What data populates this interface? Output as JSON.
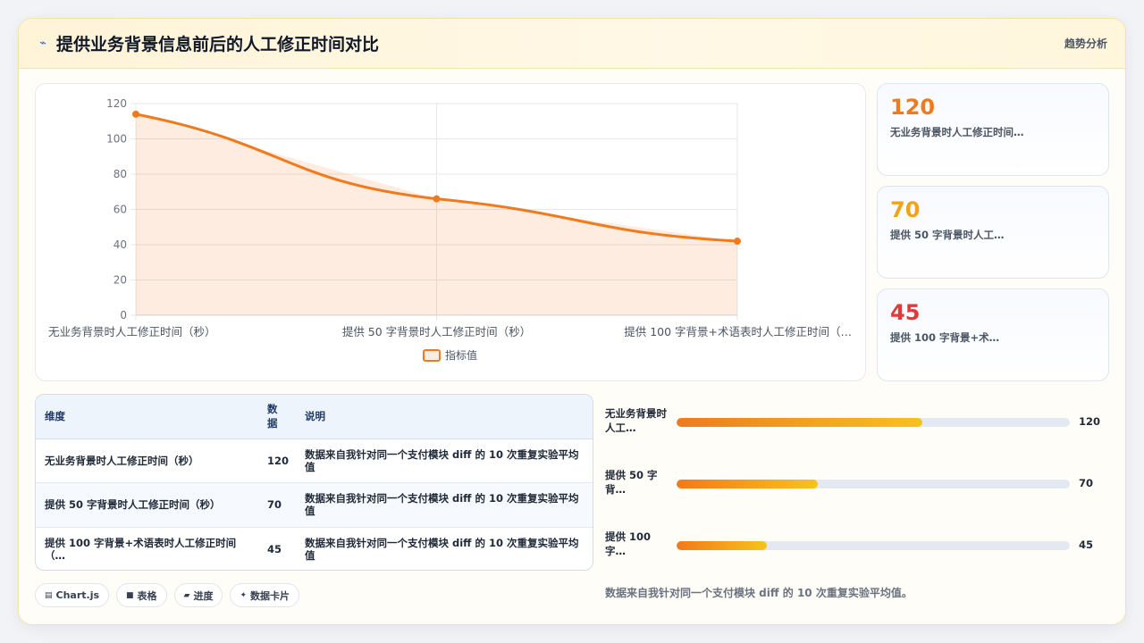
{
  "header": {
    "icon": "sparkle-icon",
    "title": "提供业务背景信息前后的人工修正时间对比",
    "badge": "趋势分析"
  },
  "chart_data": {
    "type": "area",
    "categories": [
      "无业务背景时人工修正时间（秒）",
      "提供 50 字背景时人工修正时间（秒）",
      "提供 100 字背景+术语表时人工修正时间（…"
    ],
    "series": [
      {
        "name": "指标值",
        "values": [
          114,
          66,
          42
        ],
        "color": "#f07a1c"
      }
    ],
    "ylim": [
      0,
      120
    ],
    "yticks": [
      "0",
      "20",
      "40",
      "60",
      "80",
      "100",
      "120"
    ],
    "grid": true,
    "legend": "bottom"
  },
  "stats": [
    {
      "value": "120",
      "label": "无业务背景时人工修正时间…",
      "color": "#f07a1c"
    },
    {
      "value": "70",
      "label": "提供 50 字背景时人工…",
      "color": "#f0a21c"
    },
    {
      "value": "45",
      "label": "提供 100 字背景+术…",
      "color": "#e03a3a"
    }
  ],
  "table": {
    "headers": [
      "维度",
      "数据",
      "说明"
    ],
    "rows": [
      {
        "dim": "无业务背景时人工修正时间（秒）",
        "value": "120",
        "note": "数据来自我针对同一个支付模块 diff 的 10 次重复实验平均值"
      },
      {
        "dim": "提供 50 字背景时人工修正时间（秒）",
        "value": "70",
        "note": "数据来自我针对同一个支付模块 diff 的 10 次重复实验平均值"
      },
      {
        "dim": "提供 100 字背景+术语表时人工修正时间（…",
        "value": "45",
        "note": "数据来自我针对同一个支付模块 diff 的 10 次重复实验平均值"
      }
    ]
  },
  "chips": [
    {
      "icon": "chart-icon",
      "glyph": "▤",
      "label": "Chart.js"
    },
    {
      "icon": "table-icon",
      "glyph": "■",
      "label": "表格"
    },
    {
      "icon": "progress-icon",
      "glyph": "▰",
      "label": "进度"
    },
    {
      "icon": "card-icon",
      "glyph": "✦",
      "label": "数据卡片"
    }
  ],
  "progress": [
    {
      "label": "无业务背景时人工…",
      "value": "120",
      "fraction": 0.625
    },
    {
      "label": "提供 50 字背…",
      "value": "70",
      "fraction": 0.36
    },
    {
      "label": "提供 100 字…",
      "value": "45",
      "fraction": 0.23
    }
  ],
  "footnote": "数据来自我针对同一个支付模块 diff 的 10 次重复实验平均值。"
}
